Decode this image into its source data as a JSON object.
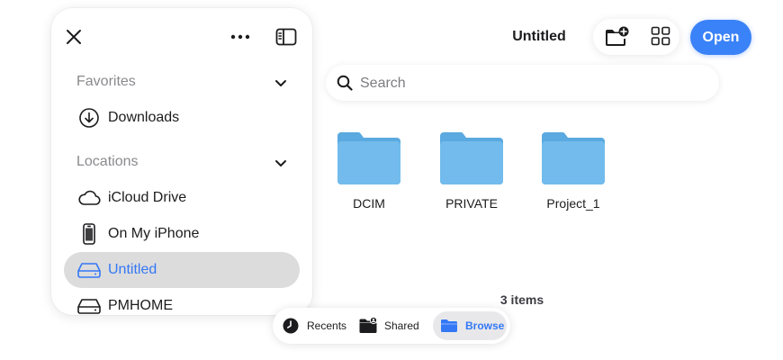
{
  "header": {
    "title": "Untitled",
    "open_label": "Open"
  },
  "sidebar": {
    "favorites_title": "Favorites",
    "locations_title": "Locations",
    "favorites": [
      {
        "label": "Downloads",
        "icon": "download-circle-icon"
      }
    ],
    "locations": [
      {
        "label": "iCloud Drive",
        "icon": "cloud-icon",
        "selected": false
      },
      {
        "label": "On My iPhone",
        "icon": "iphone-icon",
        "selected": false
      },
      {
        "label": "Untitled",
        "icon": "drive-icon",
        "selected": true
      },
      {
        "label": "PMHOME",
        "icon": "drive-icon",
        "selected": false
      }
    ]
  },
  "search": {
    "placeholder": "Search",
    "value": ""
  },
  "folders": [
    {
      "name": "DCIM"
    },
    {
      "name": "PRIVATE"
    },
    {
      "name": "Project_1"
    }
  ],
  "status": {
    "item_count": "3 items"
  },
  "tabs": [
    {
      "label": "Recents",
      "icon": "clock-icon",
      "active": false
    },
    {
      "label": "Shared",
      "icon": "shared-folder-icon",
      "active": false
    },
    {
      "label": "Browse",
      "icon": "folder-icon",
      "active": true
    }
  ],
  "colors": {
    "accent": "#3478f6",
    "folder": "#6cb4e8",
    "selected_row": "#dcdcdc"
  }
}
